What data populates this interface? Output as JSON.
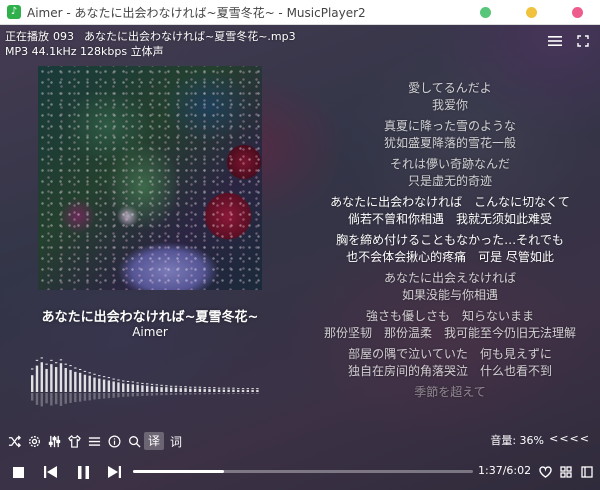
{
  "window": {
    "title": "Aimer - あなたに出会わなければ~夏雪冬花~ - MusicPlayer2",
    "app_icon": "music-note-icon"
  },
  "now_playing": {
    "label": "正在播放",
    "track_number": "093",
    "filename": "あなたに出会わなければ~夏雪冬花~.mp3",
    "format": "MP3 44.1kHz 128kbps 立体声"
  },
  "track": {
    "title": "あなたに出会わなければ~夏雪冬花~",
    "artist": "Aimer"
  },
  "lyrics": [
    {
      "jp": "愛してるんだよ",
      "cn": "我爱你",
      "state": "past"
    },
    {
      "jp": "真夏に降った雪のような",
      "cn": "犹如盛夏降落的雪花一般",
      "state": "past"
    },
    {
      "jp": "それは儚い奇跡なんだ",
      "cn": "只是虚无的奇迹",
      "state": "past"
    },
    {
      "jp": "あなたに出会わなければ　こんなに切なくて",
      "cn": "倘若不曾和你相遇　我就无须如此难受",
      "state": "current"
    },
    {
      "jp": "胸を締め付けることもなかった…それでも",
      "cn": "也不会体会揪心的疼痛　可是 尽管如此",
      "state": "current"
    },
    {
      "jp": "あなたに出会えなければ",
      "cn": "如果没能与你相遇",
      "state": "future"
    },
    {
      "jp": "強さも優しさも　知らないまま",
      "cn": "那份坚韧　那份温柔　我可能至今仍旧无法理解",
      "state": "future"
    },
    {
      "jp": "部屋の隅で泣いていた　何も見えずに",
      "cn": "独自在房间的角落哭泣　什么也看不到",
      "state": "future"
    },
    {
      "jp": "季節を超えて",
      "cn": "",
      "state": "faded"
    }
  ],
  "toolbar": {
    "lyric_translate_label": "译",
    "lyric_label": "词",
    "volume_label": "音量: 36%",
    "volume_arrows": "<<<<"
  },
  "playback": {
    "time": "1:37/6:02",
    "progress": 0.268
  },
  "spectrum": {
    "levels": [
      0.35,
      0.55,
      0.62,
      0.48,
      0.58,
      0.52,
      0.6,
      0.5,
      0.46,
      0.42,
      0.4,
      0.36,
      0.34,
      0.3,
      0.28,
      0.26,
      0.24,
      0.22,
      0.2,
      0.18,
      0.17,
      0.16,
      0.15,
      0.14,
      0.13,
      0.12,
      0.11,
      0.1,
      0.1,
      0.09,
      0.09,
      0.08,
      0.08,
      0.07,
      0.07,
      0.07,
      0.06,
      0.06,
      0.06,
      0.05,
      0.05,
      0.05,
      0.05,
      0.04,
      0.04,
      0.04,
      0.04,
      0.04
    ],
    "peak_offsets": [
      0.14,
      0.12,
      0.1,
      0.11,
      0.09,
      0.1,
      0.08,
      0.09,
      0.1,
      0.09,
      0.08,
      0.08,
      0.07,
      0.08,
      0.07,
      0.07,
      0.07,
      0.06,
      0.06,
      0.06,
      0.06,
      0.06,
      0.05,
      0.05,
      0.05,
      0.05,
      0.05,
      0.05,
      0.04,
      0.04,
      0.04,
      0.04,
      0.04,
      0.04,
      0.04,
      0.04,
      0.04,
      0.04,
      0.04,
      0.04,
      0.04,
      0.04,
      0.04,
      0.04,
      0.04,
      0.04,
      0.04,
      0.04
    ]
  },
  "colors": {
    "accent": "#ffffff",
    "titlebar": "#ffffff"
  }
}
